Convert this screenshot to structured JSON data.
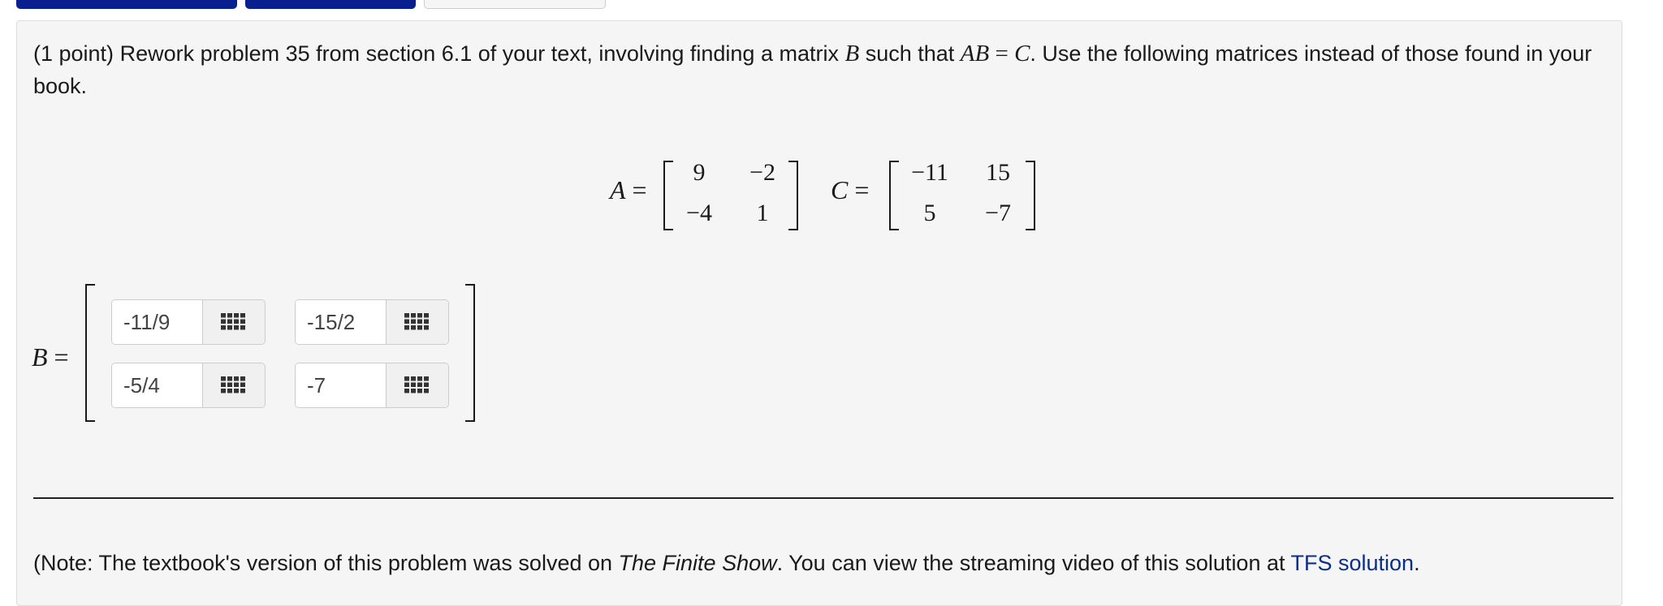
{
  "problem": {
    "points": "(1 point)",
    "text_1": " Rework problem 35 from section 6.1 of your text, involving finding a matrix ",
    "var_b": "B",
    "text_2": " such that ",
    "var_ab": "AB",
    "eq": " = ",
    "var_c": "C",
    "text_3": ". Use the following matrices instead of those found in your book."
  },
  "matrix_a": {
    "label": "A",
    "eq": "=",
    "rows": [
      [
        "9",
        "−2"
      ],
      [
        "−4",
        "1"
      ]
    ]
  },
  "matrix_c": {
    "label": "C",
    "eq": "=",
    "rows": [
      [
        "−11",
        "15"
      ],
      [
        "5",
        "−7"
      ]
    ]
  },
  "matrix_b": {
    "label": "B",
    "eq": "=",
    "inputs": [
      [
        "-11/9",
        "-15/2"
      ],
      [
        "-5/4",
        "-7"
      ]
    ],
    "button_icon": "grid-icon"
  },
  "note": {
    "prefix": "(Note: The textbook's version of this problem was solved on ",
    "show": "The Finite Show",
    "middle": ". You can view the streaming video of this solution at ",
    "link": "TFS solution",
    "suffix": "."
  },
  "colors": {
    "tab_blue": "#0a1f8f",
    "panel_bg": "#f5f5f5",
    "link": "#0b2e8a"
  }
}
